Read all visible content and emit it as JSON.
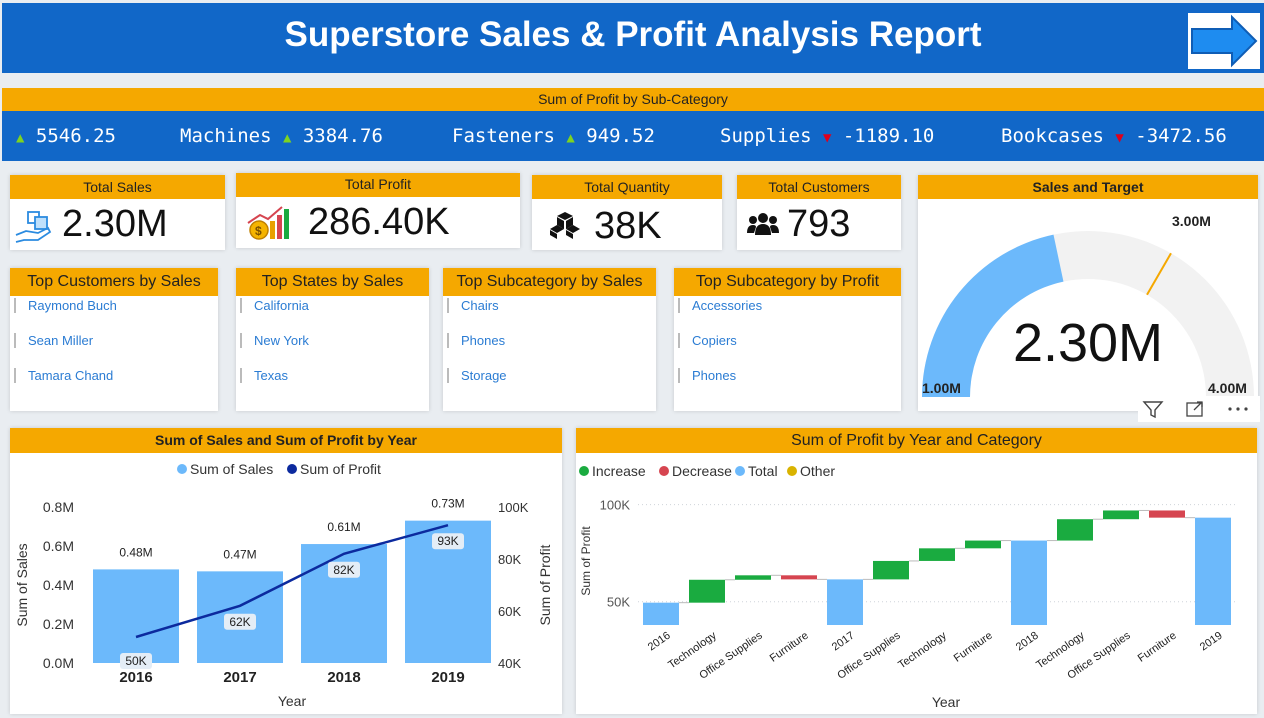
{
  "header": {
    "title": "Superstore Sales & Profit Analysis Report"
  },
  "ticker": {
    "title": "Sum of Profit by Sub-Category",
    "items": [
      {
        "name": "",
        "value": "5546.25",
        "dir": "up"
      },
      {
        "name": "Machines",
        "value": "3384.76",
        "dir": "up"
      },
      {
        "name": "Fasteners",
        "value": "949.52",
        "dir": "up"
      },
      {
        "name": "Supplies",
        "value": "-1189.10",
        "dir": "down"
      },
      {
        "name": "Bookcases",
        "value": "-3472.56",
        "dir": "down"
      }
    ]
  },
  "kpis": [
    {
      "label": "Total Sales",
      "value": "2.30M"
    },
    {
      "label": "Total Profit",
      "value": "286.40K"
    },
    {
      "label": "Total Quantity",
      "value": "38K"
    },
    {
      "label": "Total Customers",
      "value": "793"
    }
  ],
  "lists": [
    {
      "title": "Top Customers by Sales",
      "items": [
        "Raymond Buch",
        "Sean Miller",
        "Tamara Chand"
      ]
    },
    {
      "title": "Top States by Sales",
      "items": [
        "California",
        "New York",
        "Texas"
      ]
    },
    {
      "title": "Top Subcategory by Sales",
      "items": [
        "Chairs",
        "Phones",
        "Storage"
      ]
    },
    {
      "title": "Top Subcategory by Profit",
      "items": [
        "Accessories",
        "Copiers",
        "Phones"
      ]
    }
  ],
  "gauge": {
    "title": "Sales and Target",
    "value_label": "2.30M",
    "min_label": "1.00M",
    "max_label": "4.00M",
    "target_label": "3.00M",
    "value": 2.3,
    "min": 1.0,
    "max": 4.0,
    "target": 3.0,
    "fill_color": "#6cb9fb",
    "track_color": "#f2f2f2",
    "target_color": "#f5a800"
  },
  "colors": {
    "accent": "#f5a800",
    "header_blue": "#1167c8",
    "bar_blue": "#6cb9fb",
    "line_navy": "#0c2a9e",
    "increase": "#1aab40",
    "decrease": "#d64550",
    "total": "#6cb9fb",
    "other": "#d9b300"
  },
  "chart_data": [
    {
      "type": "bar",
      "title": "Sum of Sales and Sum of Profit by Year",
      "xlabel": "Year",
      "ylabel": "Sum of Sales",
      "y2label": "Sum of Profit",
      "categories": [
        "2016",
        "2017",
        "2018",
        "2019"
      ],
      "ylim": [
        0,
        0.8
      ],
      "y2lim": [
        40000,
        100000
      ],
      "yticks": [
        "0.0M",
        "0.2M",
        "0.4M",
        "0.6M",
        "0.8M"
      ],
      "y2ticks": [
        "40K",
        "60K",
        "80K",
        "100K"
      ],
      "legend_position": "top-center",
      "series": [
        {
          "name": "Sum of Sales",
          "values": [
            0.48,
            0.47,
            0.61,
            0.73
          ],
          "labels": [
            "0.48M",
            "0.47M",
            "0.61M",
            "0.73M"
          ]
        },
        {
          "name": "Sum of Profit",
          "values": [
            50000,
            62000,
            82000,
            93000
          ],
          "labels": [
            "50K",
            "62K",
            "82K",
            "93K"
          ]
        }
      ]
    },
    {
      "type": "bar",
      "subtype": "waterfall",
      "title": "Sum of Profit by Year and Category",
      "xlabel": "Year",
      "ylabel": "Sum of Profit",
      "yticks": [
        "50K",
        "100K"
      ],
      "ylim": [
        38000,
        106000
      ],
      "legend_position": "top-left",
      "legend": [
        "Increase",
        "Decrease",
        "Total",
        "Other"
      ],
      "steps": [
        {
          "label": "2016",
          "kind": "total",
          "start": 0,
          "end": 49500
        },
        {
          "label": "Technology",
          "kind": "increase",
          "start": 49500,
          "end": 61300
        },
        {
          "label": "Office Supplies",
          "kind": "increase",
          "start": 61300,
          "end": 63600
        },
        {
          "label": "Furniture",
          "kind": "decrease",
          "start": 63600,
          "end": 61500
        },
        {
          "label": "2017",
          "kind": "total",
          "start": 0,
          "end": 61500
        },
        {
          "label": "Office Supplies",
          "kind": "increase",
          "start": 61500,
          "end": 71000
        },
        {
          "label": "Technology",
          "kind": "increase",
          "start": 71000,
          "end": 77500
        },
        {
          "label": "Furniture",
          "kind": "increase",
          "start": 77500,
          "end": 81500
        },
        {
          "label": "2018",
          "kind": "total",
          "start": 0,
          "end": 81500
        },
        {
          "label": "Technology",
          "kind": "increase",
          "start": 81500,
          "end": 92500
        },
        {
          "label": "Office Supplies",
          "kind": "increase",
          "start": 92500,
          "end": 97000
        },
        {
          "label": "Furniture",
          "kind": "decrease",
          "start": 97000,
          "end": 93300
        },
        {
          "label": "2019",
          "kind": "total",
          "start": 0,
          "end": 93300
        }
      ]
    }
  ]
}
